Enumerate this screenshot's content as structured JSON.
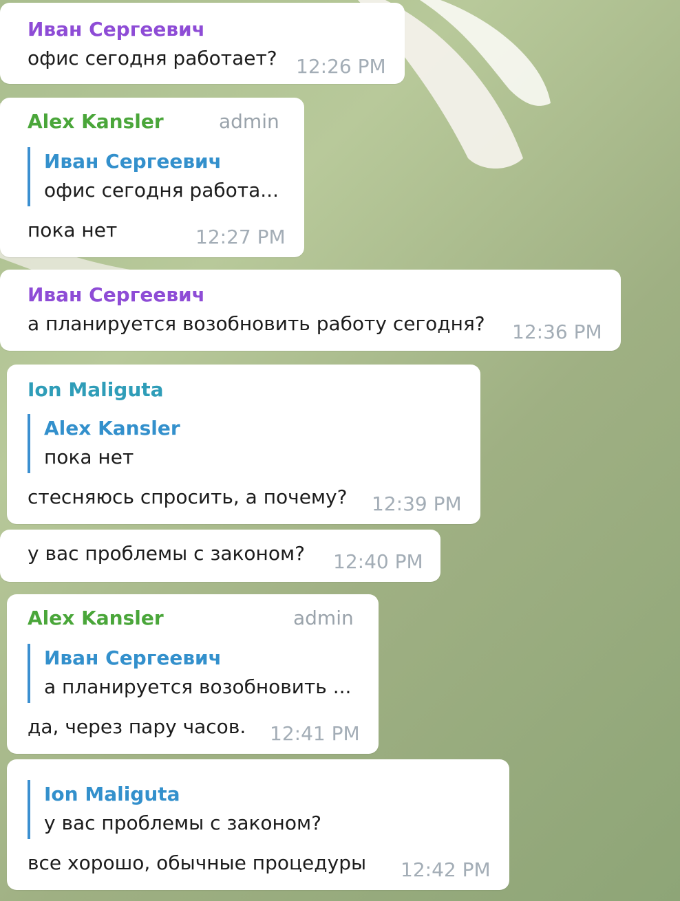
{
  "colors": {
    "purple_sender": "#8e4cd6",
    "green_sender": "#4aa63a",
    "teal_sender": "#2f9db8",
    "reply_accent": "#3b8fd0",
    "time_gray": "#a3adb6",
    "bubble": "#ffffff"
  },
  "messages": [
    {
      "sender": "Иван Сергеевич",
      "text": "офис сегодня работает?",
      "time": "12:26 PM"
    },
    {
      "sender": "Alex Kansler",
      "badge": "admin",
      "reply": {
        "name": "Иван Сергеевич",
        "text": "офис сегодня работа..."
      },
      "text": "пока нет",
      "time": "12:27 PM"
    },
    {
      "sender": "Иван Сергеевич",
      "text": "а планируется возобновить работу сегодня?",
      "time": "12:36 PM"
    },
    {
      "sender": "Ion Maliguta",
      "reply": {
        "name": "Alex Kansler",
        "text": "пока нет"
      },
      "text": "стесняюсь спросить, а почему?",
      "time": "12:39 PM"
    },
    {
      "text": "у вас проблемы с законом?",
      "time": "12:40 PM"
    },
    {
      "sender": "Alex Kansler",
      "badge": "admin",
      "reply": {
        "name": "Иван Сергеевич",
        "text": "а планируется возобновить ..."
      },
      "text": "да, через пару часов.",
      "time": "12:41 PM"
    },
    {
      "reply": {
        "name": "Ion Maliguta",
        "text": "у вас проблемы с законом?"
      },
      "text": "все хорошо, обычные процедуры",
      "time": "12:42 PM"
    }
  ]
}
